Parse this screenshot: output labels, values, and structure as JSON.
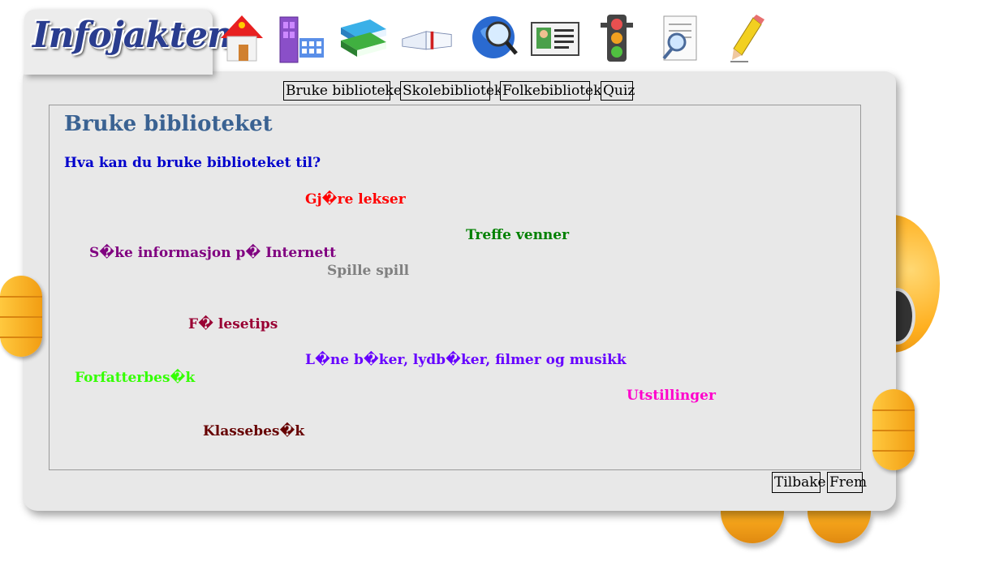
{
  "logo": {
    "text": "Infojakten"
  },
  "nav_icons": [
    {
      "name": "home-icon"
    },
    {
      "name": "library-shelf-icon"
    },
    {
      "name": "books-stack-icon"
    },
    {
      "name": "open-book-icon"
    },
    {
      "name": "globe-search-icon"
    },
    {
      "name": "id-card-icon"
    },
    {
      "name": "traffic-light-icon"
    },
    {
      "name": "document-search-icon"
    },
    {
      "name": "pencil-icon"
    }
  ],
  "tabs": [
    "Bruke biblioteket",
    "Skolebibliotek",
    "Folkebibliotek",
    "Quiz"
  ],
  "page": {
    "title": "Bruke biblioteket",
    "question": "Hva kan du bruke biblioteket til?"
  },
  "words": [
    {
      "text": "Gj�re lekser",
      "color": "#ff0000"
    },
    {
      "text": "Treffe venner",
      "color": "#008000"
    },
    {
      "text": "S�ke informasjon p� Internett",
      "color": "#800080"
    },
    {
      "text": "Spille spill",
      "color": "#808080"
    },
    {
      "text": "F� lesetips",
      "color": "#990033"
    },
    {
      "text": "L�ne b�ker, lydb�ker, filmer og musikk",
      "color": "#6600ff"
    },
    {
      "text": "Forfatterbes�k",
      "color": "#33ff00"
    },
    {
      "text": "Utstillinger",
      "color": "#ff00cc"
    },
    {
      "text": "Klassebes�k",
      "color": "#660000"
    }
  ],
  "buttons": {
    "back": "Tilbake",
    "next": "Frem"
  }
}
